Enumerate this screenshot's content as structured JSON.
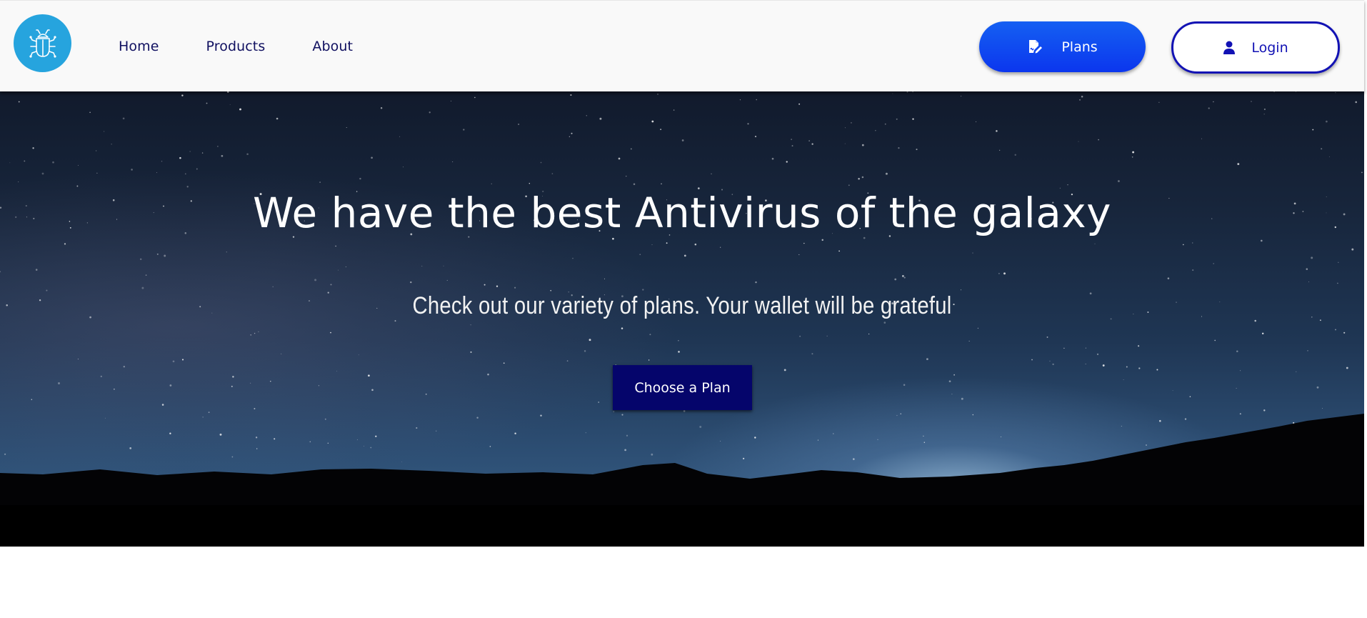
{
  "colors": {
    "logo_bg": "#26a4de",
    "nav_text": "#101060",
    "plans_button": "#0b36ee",
    "login_border": "#1212b4",
    "choose_button": "#05056b",
    "header_bg": "#f9f9f9"
  },
  "header": {
    "logo_icon": "bug-icon",
    "nav": [
      {
        "label": "Home"
      },
      {
        "label": "Products"
      },
      {
        "label": "About"
      }
    ],
    "plans_button": {
      "label": "Plans",
      "icon": "signature-document-icon"
    },
    "login_button": {
      "label": "Login",
      "icon": "user-icon"
    }
  },
  "hero": {
    "title": "We have the best Antivirus of the galaxy",
    "subtitle": "Check out our variety of plans. Your wallet will be grateful",
    "cta_label": "Choose a Plan",
    "background": "night-sky-over-mountains"
  }
}
